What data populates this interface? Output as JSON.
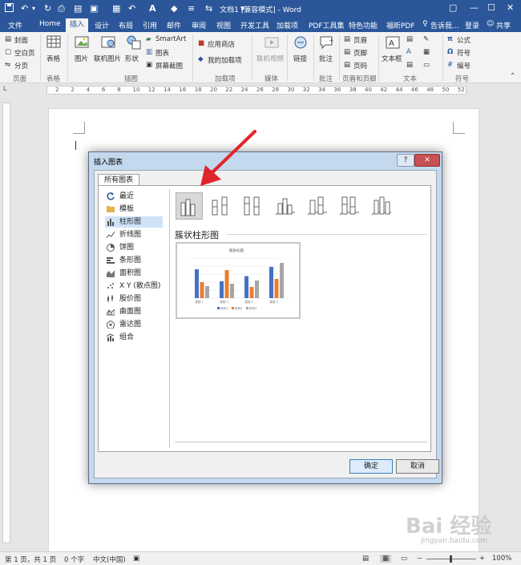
{
  "window": {
    "title": "文档1 [兼容模式] - Word",
    "minimize": "—",
    "maximize": "☐",
    "close": "✕",
    "restore": "▢"
  },
  "quick_access": {
    "save_icon": "save-icon",
    "undo_icon": "undo-icon",
    "redo_icon": "redo-icon"
  },
  "tabs": {
    "file": "文件",
    "home": "Home",
    "insert": "插入",
    "design": "设计",
    "layout": "布局",
    "references": "引用",
    "mailings": "邮件",
    "review": "审阅",
    "view": "视图",
    "developer": "开发工具",
    "addins": "加载项",
    "pdf_tools": "PDF工具集",
    "features": "特色功能",
    "foxit": "福昕PDF",
    "tellme": "告诉我...",
    "signin": "登录",
    "share": "共享"
  },
  "ribbon": {
    "pages": {
      "cover": "封面",
      "blank": "空白页",
      "break": "分页",
      "group": "页面"
    },
    "tables": {
      "table": "表格",
      "group": "表格"
    },
    "illustrations": {
      "picture": "图片",
      "online_picture": "联机图片",
      "shapes": "形状",
      "smartart": "SmartArt",
      "chart": "图表",
      "screenshot": "屏幕截图",
      "group": "插图"
    },
    "addins": {
      "store": "应用商店",
      "my_addins": "我的加载项",
      "group": "加载项"
    },
    "media": {
      "online_video": "联机视频",
      "group": "媒体"
    },
    "links": {
      "link": "链接"
    },
    "comments": {
      "comment": "批注",
      "group": "批注"
    },
    "header_footer": {
      "header": "页眉",
      "footer": "页脚",
      "page_number": "页码",
      "group": "页眉和页脚"
    },
    "text": {
      "textbox": "文本框",
      "group": "文本"
    },
    "symbols": {
      "equation": "公式",
      "symbol": "符号",
      "number": "编号",
      "group": "符号"
    }
  },
  "ruler": {
    "numbers": [
      "2",
      "2",
      "4",
      "6",
      "8",
      "10",
      "12",
      "14",
      "16",
      "18",
      "20",
      "22",
      "24",
      "26",
      "28",
      "30",
      "32",
      "34",
      "36",
      "38",
      "40",
      "42",
      "44",
      "46",
      "48",
      "50",
      "52"
    ],
    "tab_marker": "L"
  },
  "dialog": {
    "title": "插入图表",
    "help": "?",
    "close": "✕",
    "tab": "所有图表",
    "categories": [
      {
        "label": "最近",
        "icon": "recent-icon"
      },
      {
        "label": "模板",
        "icon": "folder-icon"
      },
      {
        "label": "柱形图",
        "icon": "column-chart-icon"
      },
      {
        "label": "折线图",
        "icon": "line-chart-icon"
      },
      {
        "label": "饼图",
        "icon": "pie-chart-icon"
      },
      {
        "label": "条形图",
        "icon": "bar-chart-icon"
      },
      {
        "label": "面积图",
        "icon": "area-chart-icon"
      },
      {
        "label": "X Y (散点图)",
        "icon": "scatter-chart-icon"
      },
      {
        "label": "股价图",
        "icon": "stock-chart-icon"
      },
      {
        "label": "曲面图",
        "icon": "surface-chart-icon"
      },
      {
        "label": "雷达图",
        "icon": "radar-chart-icon"
      },
      {
        "label": "组合",
        "icon": "combo-chart-icon"
      }
    ],
    "selected_category": "柱形图",
    "subtype_title": "簇状柱形图",
    "ok": "确定",
    "cancel": "取消"
  },
  "preview": {
    "title": "图表标题",
    "categories": [
      "类别 1",
      "类别 2",
      "类别 3",
      "类别 4"
    ],
    "legend": [
      "系列1",
      "系列2",
      "系列3"
    ]
  },
  "colors": {
    "accent": "#2b579a",
    "series1": "#4472c4",
    "series2": "#ed7d31",
    "series3": "#a5a5a5",
    "arrow": "#e0242b"
  },
  "statusbar": {
    "page": "第 1 页，共 1 页",
    "words": "0 个字",
    "lang": "中文(中国)",
    "zoom": "100%"
  },
  "watermark": {
    "brand": "Bai 经验",
    "url": "jingyan.baidu.com"
  }
}
